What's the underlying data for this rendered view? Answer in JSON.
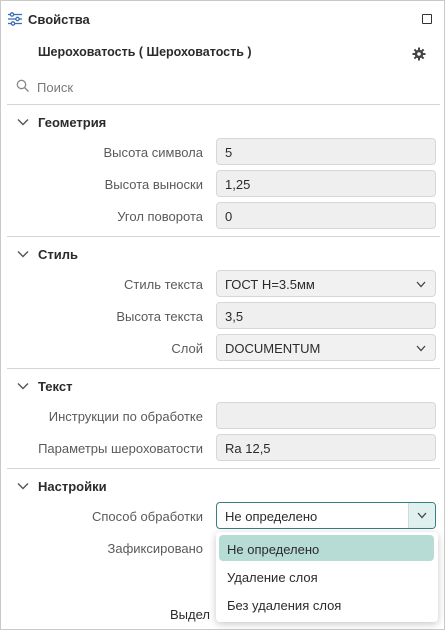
{
  "header": {
    "title": "Свойства"
  },
  "object_name": "Шероховатость ( Шероховатость )",
  "search": {
    "placeholder": "Поиск"
  },
  "sections": {
    "geometry": {
      "title": "Геометрия",
      "rows": [
        {
          "label": "Высота символа",
          "value": "5"
        },
        {
          "label": "Высота выноски",
          "value": "1,25"
        },
        {
          "label": "Угол поворота",
          "value": "0"
        }
      ]
    },
    "style": {
      "title": "Стиль",
      "rows": [
        {
          "label": "Стиль текста",
          "value": "ГОСТ Н=3.5мм"
        },
        {
          "label": "Высота текста",
          "value": "3,5"
        },
        {
          "label": "Слой",
          "value": "DOCUMENTUM"
        }
      ]
    },
    "text": {
      "title": "Текст",
      "rows": [
        {
          "label": "Инструкции по обработке",
          "value": ""
        },
        {
          "label": "Параметры шероховатости",
          "value": "Ra 12,5"
        }
      ]
    },
    "settings": {
      "title": "Настройки",
      "rows": [
        {
          "label": "Способ обработки",
          "value": "Не определено"
        },
        {
          "label": "Зафиксировано",
          "value": ""
        }
      ],
      "truncated_label": "Выдел"
    }
  },
  "dropdown": {
    "options": [
      {
        "label": "Не определено",
        "selected": true
      },
      {
        "label": "Удаление слоя",
        "selected": false
      },
      {
        "label": "Без удаления слоя",
        "selected": false
      }
    ]
  },
  "colors": {
    "accent": "#3a7f7f",
    "selected_option": "#b7dcd6",
    "field_bg": "#efefef"
  },
  "icons": [
    "properties-icon",
    "maximize-icon",
    "gear-icon",
    "search-icon",
    "chevron-down-icon"
  ]
}
